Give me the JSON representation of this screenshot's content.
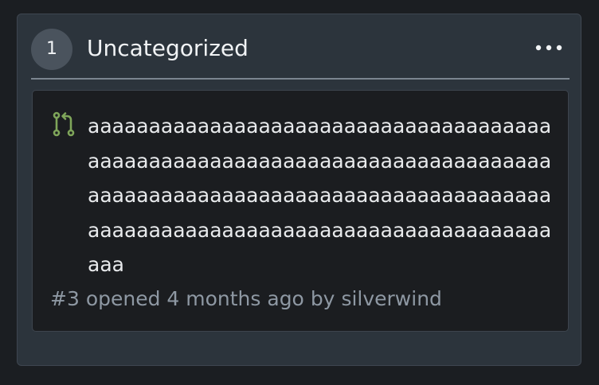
{
  "column": {
    "count": "1",
    "title": "Uncategorized",
    "menu_icon": "kebab-horizontal-icon"
  },
  "card": {
    "icon": "pull-request-icon",
    "icon_color": "#7fa65a",
    "title": "aaaaaaaaaaaaaaaaaaaaaaaaaaaaaaaaaaaaaaaaaaaaaaaaaaaaaaaaaaaaaaaaaaaaaaaaaaaaaaaaaaaaaaaaaaaaaaaaaaaaaaaaaaaaaaaaaaaaaaaaaaaaaaaaaaaaaaaaaaaaaaaaaaaaaaaaaaa",
    "number": "#3",
    "opened_text": "opened",
    "time": "4 months ago",
    "by_text": "by",
    "author": "silverwind"
  }
}
